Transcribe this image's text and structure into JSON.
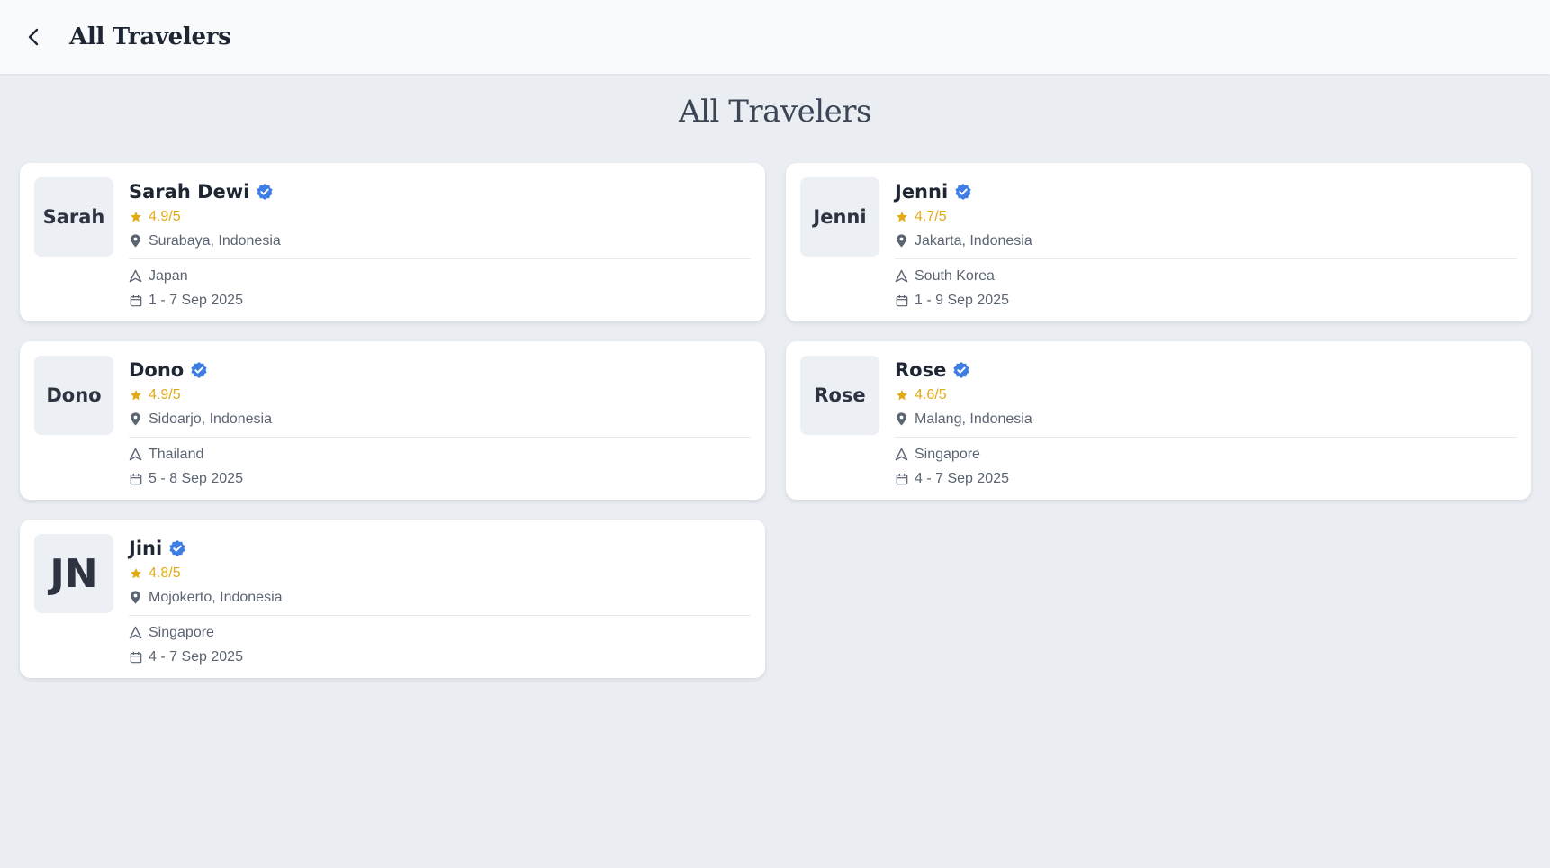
{
  "header": {
    "title": "All Travelers"
  },
  "page": {
    "title": "All Travelers"
  },
  "colors": {
    "verified": "#3d7de4",
    "star": "#e3aa16",
    "background": "#eaeef2"
  },
  "travelers": [
    {
      "avatar": "Sarah",
      "name": "Sarah Dewi",
      "rating": "4.9/5",
      "location": "Surabaya, Indonesia",
      "destination": "Japan",
      "dates": "1 - 7 Sep 2025"
    },
    {
      "avatar": "Jenni",
      "name": "Jenni",
      "rating": "4.7/5",
      "location": "Jakarta, Indonesia",
      "destination": "South Korea",
      "dates": "1 - 9 Sep 2025"
    },
    {
      "avatar": "Dono",
      "name": "Dono",
      "rating": "4.9/5",
      "location": "Sidoarjo, Indonesia",
      "destination": "Thailand",
      "dates": "5 - 8 Sep 2025"
    },
    {
      "avatar": "Rose",
      "name": "Rose",
      "rating": "4.6/5",
      "location": "Malang, Indonesia",
      "destination": "Singapore",
      "dates": "4 - 7 Sep 2025"
    },
    {
      "avatar": "JN",
      "name": "Jini",
      "rating": "4.8/5",
      "location": "Mojokerto, Indonesia",
      "destination": "Singapore",
      "dates": "4 - 7 Sep 2025"
    }
  ]
}
